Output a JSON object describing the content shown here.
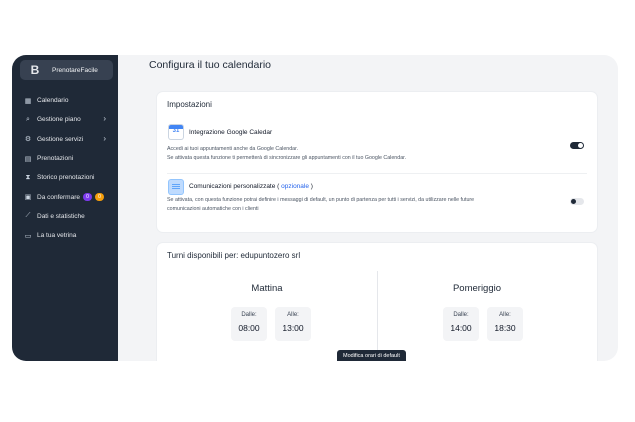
{
  "sidebar": {
    "brand_logo": "B",
    "brand_name": "PrenotareFacile",
    "items": [
      {
        "label": "Calendario"
      },
      {
        "label": "Gestione piano"
      },
      {
        "label": "Gestione servizi"
      },
      {
        "label": "Prenotazioni"
      },
      {
        "label": "Storico prenotazioni"
      },
      {
        "label": "Da confermare",
        "badge1": "0",
        "badge2": "0"
      },
      {
        "label": "Dati e statistiche"
      },
      {
        "label": "La tua vetrina"
      }
    ]
  },
  "main": {
    "title": "Configura il tuo calendario",
    "settings": {
      "title": "Impostazioni",
      "google": {
        "icon_num": "31",
        "title": "Integrazione Google Caledar",
        "desc1": "Accedi ai tuoi appuntamenti anche da Google Calendar.",
        "desc2": "Se attivata questa funzione ti permetterà di sincronizzare gli appuntamenti con il tuo Google Calendar.",
        "enabled": true
      },
      "messages": {
        "title_prefix": "Comunicazioni personalizzate ( ",
        "title_link": "opzionale",
        "title_suffix": " )",
        "desc1": "Se attivata, con questa funzione potrai definire i messaggi di default, un punto di partenza per tutti i servizi, da utilizzare nelle future",
        "desc2": "comunicazioni automatiche con i clienti",
        "enabled": false
      }
    },
    "shifts": {
      "title": "Turni disponibili per: edupuntozero srl",
      "morning": {
        "name": "Mattina",
        "from_label": "Dalle:",
        "from": "08:00",
        "to_label": "Alle:",
        "to": "13:00"
      },
      "afternoon": {
        "name": "Pomeriggio",
        "from_label": "Dalle:",
        "from": "14:00",
        "to_label": "Alle:",
        "to": "18:30"
      }
    },
    "tooltip": "Modifica orari di default"
  }
}
